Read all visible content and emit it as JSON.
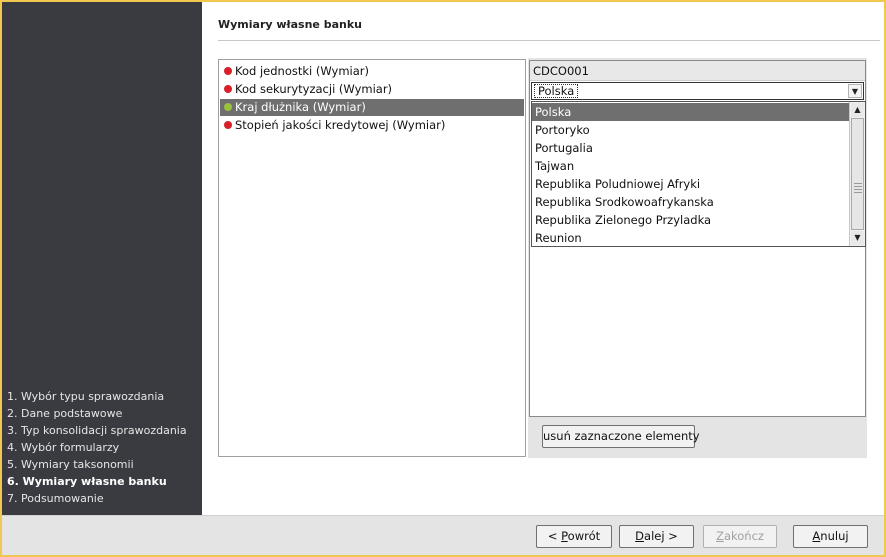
{
  "wizard": {
    "section_title": "Wymiary własne banku",
    "steps": [
      {
        "label": "1. Wybór typu sprawozdania",
        "active": false
      },
      {
        "label": "2. Dane podstawowe",
        "active": false
      },
      {
        "label": "3. Typ konsolidacji sprawozdania",
        "active": false
      },
      {
        "label": "4. Wybór formularzy",
        "active": false
      },
      {
        "label": "5. Wymiary taksonomii",
        "active": false
      },
      {
        "label": "6. Wymiary własne banku",
        "active": true
      },
      {
        "label": "7. Podsumowanie",
        "active": false
      }
    ]
  },
  "dimensions": [
    {
      "label": "Kod jednostki (Wymiar)",
      "status_color": "#d8202a"
    },
    {
      "label": "Kod sekurytyzacji (Wymiar)",
      "status_color": "#d8202a"
    },
    {
      "label": "Kraj dłużnika (Wymiar)",
      "status_color": "#9ac23c"
    },
    {
      "label": "Stopień jakości kredytowej (Wymiar)",
      "status_color": "#d8202a"
    }
  ],
  "member_panel": {
    "header": "CDCO001",
    "selected_value": "Polska",
    "options": [
      "Polska",
      "Portoryko",
      "Portugalia",
      "Tajwan",
      "Republika Poludniowej Afryki",
      "Republika Srodkowoafrykanska",
      "Republika Zielonego Przyladka",
      "Reunion"
    ],
    "remove_button": "usuń zaznaczone elementy"
  },
  "footer": {
    "back_prefix": "< ",
    "back_key": "P",
    "back_rest": "owrót",
    "next_key": "D",
    "next_rest": "alej >",
    "finish_key": "Z",
    "finish_rest": "akończ",
    "cancel_key": "A",
    "cancel_rest": "nuluj"
  },
  "icons": {
    "combo_arrow": "▼",
    "scroll_up": "▲",
    "scroll_down": "▼"
  }
}
